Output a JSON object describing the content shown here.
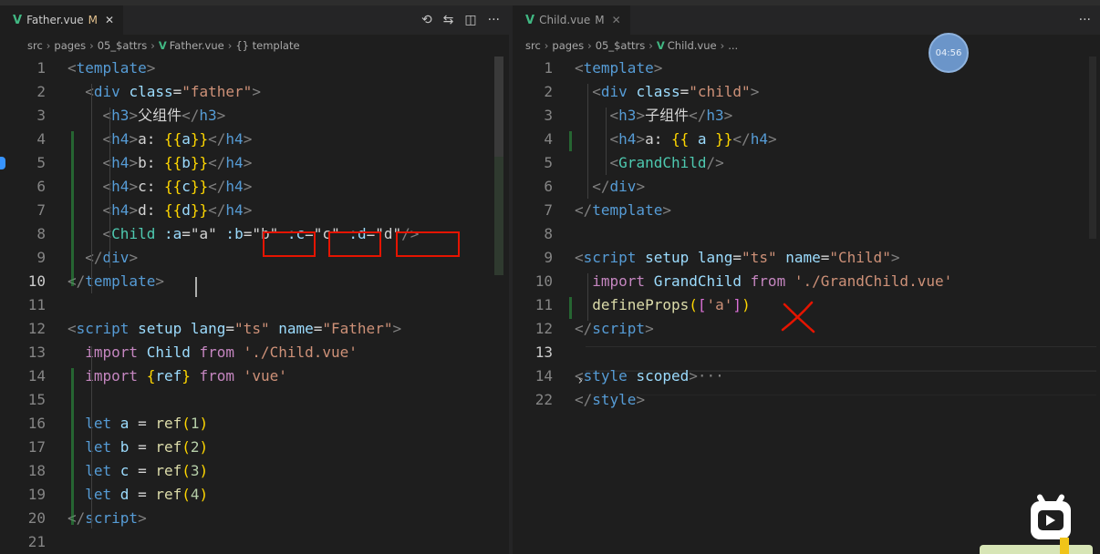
{
  "left_pane": {
    "tab": {
      "name": "Father.vue",
      "modified": "M",
      "close": "✕"
    },
    "actions": [
      "⟲",
      "⇆",
      "◫",
      "···"
    ],
    "breadcrumb": [
      "src",
      "pages",
      "05_$attrs",
      "Father.vue",
      "{} template"
    ],
    "lines": [
      {
        "n": "1",
        "tokens": [
          [
            "<",
            "#808080"
          ],
          [
            "template",
            "#569cd6"
          ],
          [
            ">",
            "#808080"
          ]
        ]
      },
      {
        "n": "2",
        "tokens": [
          [
            "  ",
            "#d4d4d4"
          ],
          [
            "<",
            "#808080"
          ],
          [
            "div",
            "#569cd6"
          ],
          [
            " class",
            "#9cdcfe"
          ],
          [
            "=",
            "#d4d4d4"
          ],
          [
            "\"father\"",
            "#ce9178"
          ],
          [
            ">",
            "#808080"
          ]
        ]
      },
      {
        "n": "3",
        "tokens": [
          [
            "    ",
            "#d4d4d4"
          ],
          [
            "<",
            "#808080"
          ],
          [
            "h3",
            "#569cd6"
          ],
          [
            ">",
            "#808080"
          ],
          [
            "父组件",
            "#d4d4d4"
          ],
          [
            "</",
            "#808080"
          ],
          [
            "h3",
            "#569cd6"
          ],
          [
            ">",
            "#808080"
          ]
        ]
      },
      {
        "n": "4",
        "tokens": [
          [
            "    ",
            "#d4d4d4"
          ],
          [
            "<",
            "#808080"
          ],
          [
            "h4",
            "#569cd6"
          ],
          [
            ">",
            "#808080"
          ],
          [
            "a: ",
            "#d4d4d4"
          ],
          [
            "{{",
            "#ffd700"
          ],
          [
            "a",
            "#9cdcfe"
          ],
          [
            "}}",
            "#ffd700"
          ],
          [
            "</",
            "#808080"
          ],
          [
            "h4",
            "#569cd6"
          ],
          [
            ">",
            "#808080"
          ]
        ]
      },
      {
        "n": "5",
        "tokens": [
          [
            "    ",
            "#d4d4d4"
          ],
          [
            "<",
            "#808080"
          ],
          [
            "h4",
            "#569cd6"
          ],
          [
            ">",
            "#808080"
          ],
          [
            "b: ",
            "#d4d4d4"
          ],
          [
            "{{",
            "#ffd700"
          ],
          [
            "b",
            "#9cdcfe"
          ],
          [
            "}}",
            "#ffd700"
          ],
          [
            "</",
            "#808080"
          ],
          [
            "h4",
            "#569cd6"
          ],
          [
            ">",
            "#808080"
          ]
        ]
      },
      {
        "n": "6",
        "tokens": [
          [
            "    ",
            "#d4d4d4"
          ],
          [
            "<",
            "#808080"
          ],
          [
            "h4",
            "#569cd6"
          ],
          [
            ">",
            "#808080"
          ],
          [
            "c: ",
            "#d4d4d4"
          ],
          [
            "{{",
            "#ffd700"
          ],
          [
            "c",
            "#9cdcfe"
          ],
          [
            "}}",
            "#ffd700"
          ],
          [
            "</",
            "#808080"
          ],
          [
            "h4",
            "#569cd6"
          ],
          [
            ">",
            "#808080"
          ]
        ]
      },
      {
        "n": "7",
        "tokens": [
          [
            "    ",
            "#d4d4d4"
          ],
          [
            "<",
            "#808080"
          ],
          [
            "h4",
            "#569cd6"
          ],
          [
            ">",
            "#808080"
          ],
          [
            "d: ",
            "#d4d4d4"
          ],
          [
            "{{",
            "#ffd700"
          ],
          [
            "d",
            "#9cdcfe"
          ],
          [
            "}}",
            "#ffd700"
          ],
          [
            "</",
            "#808080"
          ],
          [
            "h4",
            "#569cd6"
          ],
          [
            ">",
            "#808080"
          ]
        ]
      },
      {
        "n": "8",
        "tokens": [
          [
            "    ",
            "#d4d4d4"
          ],
          [
            "<",
            "#808080"
          ],
          [
            "Child",
            "#4ec9b0"
          ],
          [
            " :a",
            "#9cdcfe"
          ],
          [
            "=",
            "#d4d4d4"
          ],
          [
            "\"a\"",
            "#d4d4d4"
          ],
          [
            " :b",
            "#9cdcfe"
          ],
          [
            "=",
            "#d4d4d4"
          ],
          [
            "\"b\"",
            "#d4d4d4"
          ],
          [
            " :c",
            "#9cdcfe"
          ],
          [
            "=",
            "#d4d4d4"
          ],
          [
            "\"c\"",
            "#d4d4d4"
          ],
          [
            " :d",
            "#9cdcfe"
          ],
          [
            "=",
            "#d4d4d4"
          ],
          [
            "\"d\"",
            "#d4d4d4"
          ],
          [
            "/>",
            "#808080"
          ]
        ]
      },
      {
        "n": "9",
        "tokens": [
          [
            "  ",
            "#d4d4d4"
          ],
          [
            "</",
            "#808080"
          ],
          [
            "div",
            "#569cd6"
          ],
          [
            ">",
            "#808080"
          ]
        ]
      },
      {
        "n": "10",
        "tokens": [
          [
            "</",
            "#808080"
          ],
          [
            "template",
            "#569cd6"
          ],
          [
            ">",
            "#808080"
          ]
        ]
      },
      {
        "n": "11",
        "tokens": []
      },
      {
        "n": "12",
        "tokens": [
          [
            "<",
            "#808080"
          ],
          [
            "script",
            "#569cd6"
          ],
          [
            " setup",
            "#9cdcfe"
          ],
          [
            " lang",
            "#9cdcfe"
          ],
          [
            "=",
            "#d4d4d4"
          ],
          [
            "\"ts\"",
            "#ce9178"
          ],
          [
            " name",
            "#9cdcfe"
          ],
          [
            "=",
            "#d4d4d4"
          ],
          [
            "\"Father\"",
            "#ce9178"
          ],
          [
            ">",
            "#808080"
          ]
        ]
      },
      {
        "n": "13",
        "tokens": [
          [
            "  ",
            "#d4d4d4"
          ],
          [
            "import",
            "#c586c0"
          ],
          [
            " Child",
            "#9cdcfe"
          ],
          [
            " from",
            "#c586c0"
          ],
          [
            " './Child.vue'",
            "#ce9178"
          ]
        ]
      },
      {
        "n": "14",
        "tokens": [
          [
            "  ",
            "#d4d4d4"
          ],
          [
            "import",
            "#c586c0"
          ],
          [
            " {",
            "#ffd700"
          ],
          [
            "ref",
            "#9cdcfe"
          ],
          [
            "}",
            "#ffd700"
          ],
          [
            " from",
            "#c586c0"
          ],
          [
            " 'vue'",
            "#ce9178"
          ]
        ]
      },
      {
        "n": "15",
        "tokens": []
      },
      {
        "n": "16",
        "tokens": [
          [
            "  ",
            "#d4d4d4"
          ],
          [
            "let",
            "#569cd6"
          ],
          [
            " a",
            "#9cdcfe"
          ],
          [
            " = ",
            "#d4d4d4"
          ],
          [
            "ref",
            "#dcdcaa"
          ],
          [
            "(",
            "#ffd700"
          ],
          [
            "1",
            "#b5cea8"
          ],
          [
            ")",
            "#ffd700"
          ]
        ]
      },
      {
        "n": "17",
        "tokens": [
          [
            "  ",
            "#d4d4d4"
          ],
          [
            "let",
            "#569cd6"
          ],
          [
            " b",
            "#9cdcfe"
          ],
          [
            " = ",
            "#d4d4d4"
          ],
          [
            "ref",
            "#dcdcaa"
          ],
          [
            "(",
            "#ffd700"
          ],
          [
            "2",
            "#b5cea8"
          ],
          [
            ")",
            "#ffd700"
          ]
        ]
      },
      {
        "n": "18",
        "tokens": [
          [
            "  ",
            "#d4d4d4"
          ],
          [
            "let",
            "#569cd6"
          ],
          [
            " c",
            "#9cdcfe"
          ],
          [
            " = ",
            "#d4d4d4"
          ],
          [
            "ref",
            "#dcdcaa"
          ],
          [
            "(",
            "#ffd700"
          ],
          [
            "3",
            "#b5cea8"
          ],
          [
            ")",
            "#ffd700"
          ]
        ]
      },
      {
        "n": "19",
        "tokens": [
          [
            "  ",
            "#d4d4d4"
          ],
          [
            "let",
            "#569cd6"
          ],
          [
            " d",
            "#9cdcfe"
          ],
          [
            " = ",
            "#d4d4d4"
          ],
          [
            "ref",
            "#dcdcaa"
          ],
          [
            "(",
            "#ffd700"
          ],
          [
            "4",
            "#b5cea8"
          ],
          [
            ")",
            "#ffd700"
          ]
        ]
      },
      {
        "n": "20",
        "tokens": [
          [
            "</",
            "#808080"
          ],
          [
            "script",
            "#569cd6"
          ],
          [
            ">",
            "#808080"
          ]
        ]
      },
      {
        "n": "21",
        "tokens": []
      }
    ]
  },
  "right_pane": {
    "tab": {
      "name": "Child.vue",
      "modified": "M",
      "close": "✕"
    },
    "actions": [
      "···"
    ],
    "breadcrumb": [
      "src",
      "pages",
      "05_$attrs",
      "Child.vue",
      "..."
    ],
    "lines": [
      {
        "n": "1",
        "tokens": [
          [
            "<",
            "#808080"
          ],
          [
            "template",
            "#569cd6"
          ],
          [
            ">",
            "#808080"
          ]
        ]
      },
      {
        "n": "2",
        "tokens": [
          [
            "  ",
            "#d4d4d4"
          ],
          [
            "<",
            "#808080"
          ],
          [
            "div",
            "#569cd6"
          ],
          [
            " class",
            "#9cdcfe"
          ],
          [
            "=",
            "#d4d4d4"
          ],
          [
            "\"child\"",
            "#ce9178"
          ],
          [
            ">",
            "#808080"
          ]
        ]
      },
      {
        "n": "3",
        "tokens": [
          [
            "    ",
            "#d4d4d4"
          ],
          [
            "<",
            "#808080"
          ],
          [
            "h3",
            "#569cd6"
          ],
          [
            ">",
            "#808080"
          ],
          [
            "子组件",
            "#d4d4d4"
          ],
          [
            "</",
            "#808080"
          ],
          [
            "h3",
            "#569cd6"
          ],
          [
            ">",
            "#808080"
          ]
        ]
      },
      {
        "n": "4",
        "tokens": [
          [
            "    ",
            "#d4d4d4"
          ],
          [
            "<",
            "#808080"
          ],
          [
            "h4",
            "#569cd6"
          ],
          [
            ">",
            "#808080"
          ],
          [
            "a: ",
            "#d4d4d4"
          ],
          [
            "{{",
            "#ffd700"
          ],
          [
            " a ",
            "#9cdcfe"
          ],
          [
            "}}",
            "#ffd700"
          ],
          [
            "</",
            "#808080"
          ],
          [
            "h4",
            "#569cd6"
          ],
          [
            ">",
            "#808080"
          ]
        ]
      },
      {
        "n": "5",
        "tokens": [
          [
            "    ",
            "#d4d4d4"
          ],
          [
            "<",
            "#808080"
          ],
          [
            "GrandChild",
            "#4ec9b0"
          ],
          [
            "/>",
            "#808080"
          ]
        ]
      },
      {
        "n": "6",
        "tokens": [
          [
            "  ",
            "#d4d4d4"
          ],
          [
            "</",
            "#808080"
          ],
          [
            "div",
            "#569cd6"
          ],
          [
            ">",
            "#808080"
          ]
        ]
      },
      {
        "n": "7",
        "tokens": [
          [
            "</",
            "#808080"
          ],
          [
            "template",
            "#569cd6"
          ],
          [
            ">",
            "#808080"
          ]
        ]
      },
      {
        "n": "8",
        "tokens": []
      },
      {
        "n": "9",
        "tokens": [
          [
            "<",
            "#808080"
          ],
          [
            "script",
            "#569cd6"
          ],
          [
            " setup",
            "#9cdcfe"
          ],
          [
            " lang",
            "#9cdcfe"
          ],
          [
            "=",
            "#d4d4d4"
          ],
          [
            "\"ts\"",
            "#ce9178"
          ],
          [
            " name",
            "#9cdcfe"
          ],
          [
            "=",
            "#d4d4d4"
          ],
          [
            "\"Child\"",
            "#ce9178"
          ],
          [
            ">",
            "#808080"
          ]
        ]
      },
      {
        "n": "10",
        "tokens": [
          [
            "  ",
            "#d4d4d4"
          ],
          [
            "import",
            "#c586c0"
          ],
          [
            " GrandChild",
            "#9cdcfe"
          ],
          [
            " from",
            "#c586c0"
          ],
          [
            " './GrandChild.vue'",
            "#ce9178"
          ]
        ]
      },
      {
        "n": "11",
        "tokens": [
          [
            "  ",
            "#d4d4d4"
          ],
          [
            "defineProps",
            "#dcdcaa"
          ],
          [
            "(",
            "#ffd700"
          ],
          [
            "[",
            "#da70d6"
          ],
          [
            "'a'",
            "#ce9178"
          ],
          [
            "]",
            "#da70d6"
          ],
          [
            ")",
            "#ffd700"
          ]
        ]
      },
      {
        "n": "12",
        "tokens": [
          [
            "</",
            "#808080"
          ],
          [
            "script",
            "#569cd6"
          ],
          [
            ">",
            "#808080"
          ]
        ]
      },
      {
        "n": "13",
        "tokens": []
      },
      {
        "n": "14",
        "tokens": [
          [
            "<",
            "#808080"
          ],
          [
            "style",
            "#569cd6"
          ],
          [
            " scoped",
            "#9cdcfe"
          ],
          [
            ">",
            "#808080"
          ],
          [
            "···",
            "#858585"
          ]
        ]
      },
      {
        "n": "22",
        "tokens": [
          [
            "</",
            "#808080"
          ],
          [
            "style",
            "#569cd6"
          ],
          [
            ">",
            "#808080"
          ]
        ]
      }
    ]
  },
  "overlay": {
    "timer": "04:56"
  }
}
